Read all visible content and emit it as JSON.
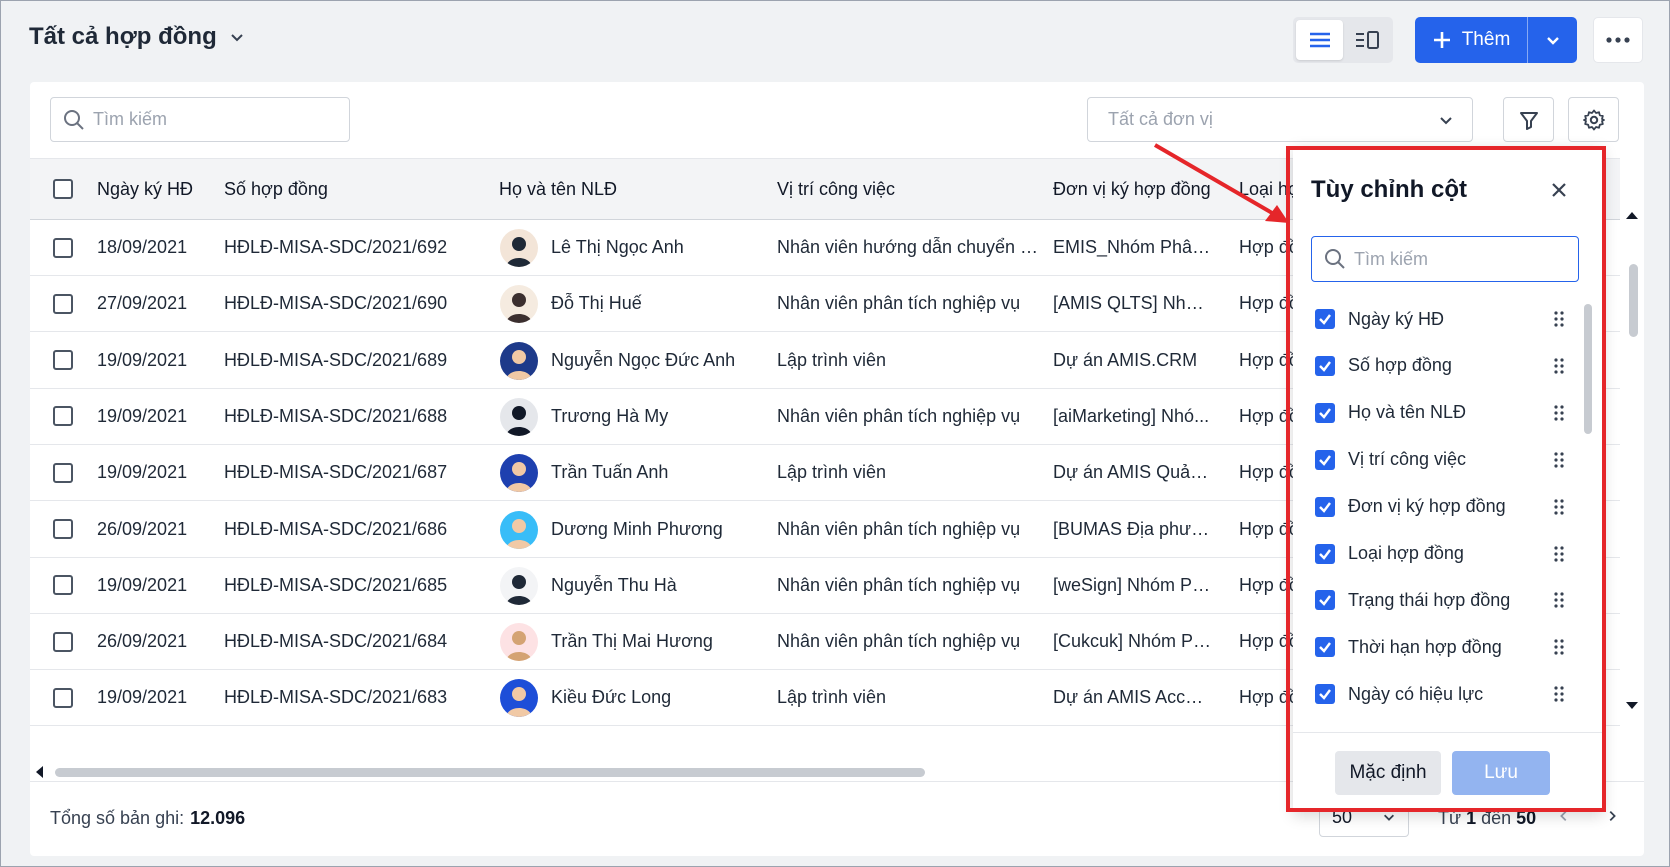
{
  "header": {
    "title": "Tất cả hợp đồng",
    "add_label": "Thêm"
  },
  "toolbar": {
    "search_placeholder": "Tìm kiếm",
    "unit_placeholder": "Tất cả đơn vị"
  },
  "table": {
    "columns": [
      "Ngày ký HĐ",
      "Số hợp đồng",
      "Họ và tên NLĐ",
      "Vị trí công việc",
      "Đơn vị ký hợp đồng",
      "Loại hợp"
    ],
    "rows": [
      {
        "date": "18/09/2021",
        "no": "HĐLĐ-MISA-SDC/2021/692",
        "name": "Lê Thị Ngọc Anh",
        "position": "Nhân viên hướng dẫn chuyển g...",
        "unit": "EMIS_Nhóm Phân t...",
        "type": "Hợp đồng"
      },
      {
        "date": "27/09/2021",
        "no": "HĐLĐ-MISA-SDC/2021/690",
        "name": "Đỗ Thị Huế",
        "position": "Nhân viên phân tích nghiệp vụ",
        "unit": "[AMIS QLTS] Nhóm...",
        "type": "Hợp đồng"
      },
      {
        "date": "19/09/2021",
        "no": "HĐLĐ-MISA-SDC/2021/689",
        "name": "Nguyễn Ngọc Đức Anh",
        "position": "Lập trình viên",
        "unit": "Dự án AMIS.CRM",
        "type": "Hợp đồng"
      },
      {
        "date": "19/09/2021",
        "no": "HĐLĐ-MISA-SDC/2021/688",
        "name": "Trương Hà My",
        "position": "Nhân viên phân tích nghiệp vụ",
        "unit": "[aiMarketing] Nhó...",
        "type": "Hợp đồng"
      },
      {
        "date": "19/09/2021",
        "no": "HĐLĐ-MISA-SDC/2021/687",
        "name": "Trần Tuấn Anh",
        "position": "Lập trình viên",
        "unit": "Dự án AMIS Quản l...",
        "type": "Hợp đồng"
      },
      {
        "date": "26/09/2021",
        "no": "HĐLĐ-MISA-SDC/2021/686",
        "name": "Dương Minh Phương",
        "position": "Nhân viên phân tích nghiệp vụ",
        "unit": "[BUMAS Địa phươn...",
        "type": "Hợp đồng"
      },
      {
        "date": "19/09/2021",
        "no": "HĐLĐ-MISA-SDC/2021/685",
        "name": "Nguyễn Thu Hà",
        "position": "Nhân viên phân tích nghiệp vụ",
        "unit": "[weSign] Nhóm Ph...",
        "type": "Hợp đồng"
      },
      {
        "date": "26/09/2021",
        "no": "HĐLĐ-MISA-SDC/2021/684",
        "name": "Trần Thị Mai Hương",
        "position": "Nhân viên phân tích nghiệp vụ",
        "unit": "[Cukcuk] Nhóm Ph...",
        "type": "Hợp đồng"
      },
      {
        "date": "19/09/2021",
        "no": "HĐLĐ-MISA-SDC/2021/683",
        "name": "Kiều Đức Long",
        "position": "Lập trình viên",
        "unit": "Dự án AMIS Accou...",
        "type": "Hợp đồng"
      }
    ]
  },
  "footer": {
    "total_label": "Tổng số bản ghi:",
    "total_value": "12.096",
    "page_size": "50",
    "range_prefix": "Từ",
    "range_from": "1",
    "range_mid": "đến",
    "range_to": "50"
  },
  "panel": {
    "title": "Tùy chỉnh cột",
    "search_placeholder": "Tìm kiếm",
    "columns": [
      "Ngày ký HĐ",
      "Số hợp đồng",
      "Họ và tên NLĐ",
      "Vị trí công việc",
      "Đơn vị ký hợp đồng",
      "Loại hợp đồng",
      "Trạng thái hợp đồng",
      "Thời hạn hợp đồng",
      "Ngày có hiệu lực"
    ],
    "default_label": "Mặc định",
    "save_label": "Lưu"
  },
  "colors": {
    "primary": "#2563eb",
    "annotation": "#e5262a",
    "save_disabled": "#93b4f0"
  }
}
